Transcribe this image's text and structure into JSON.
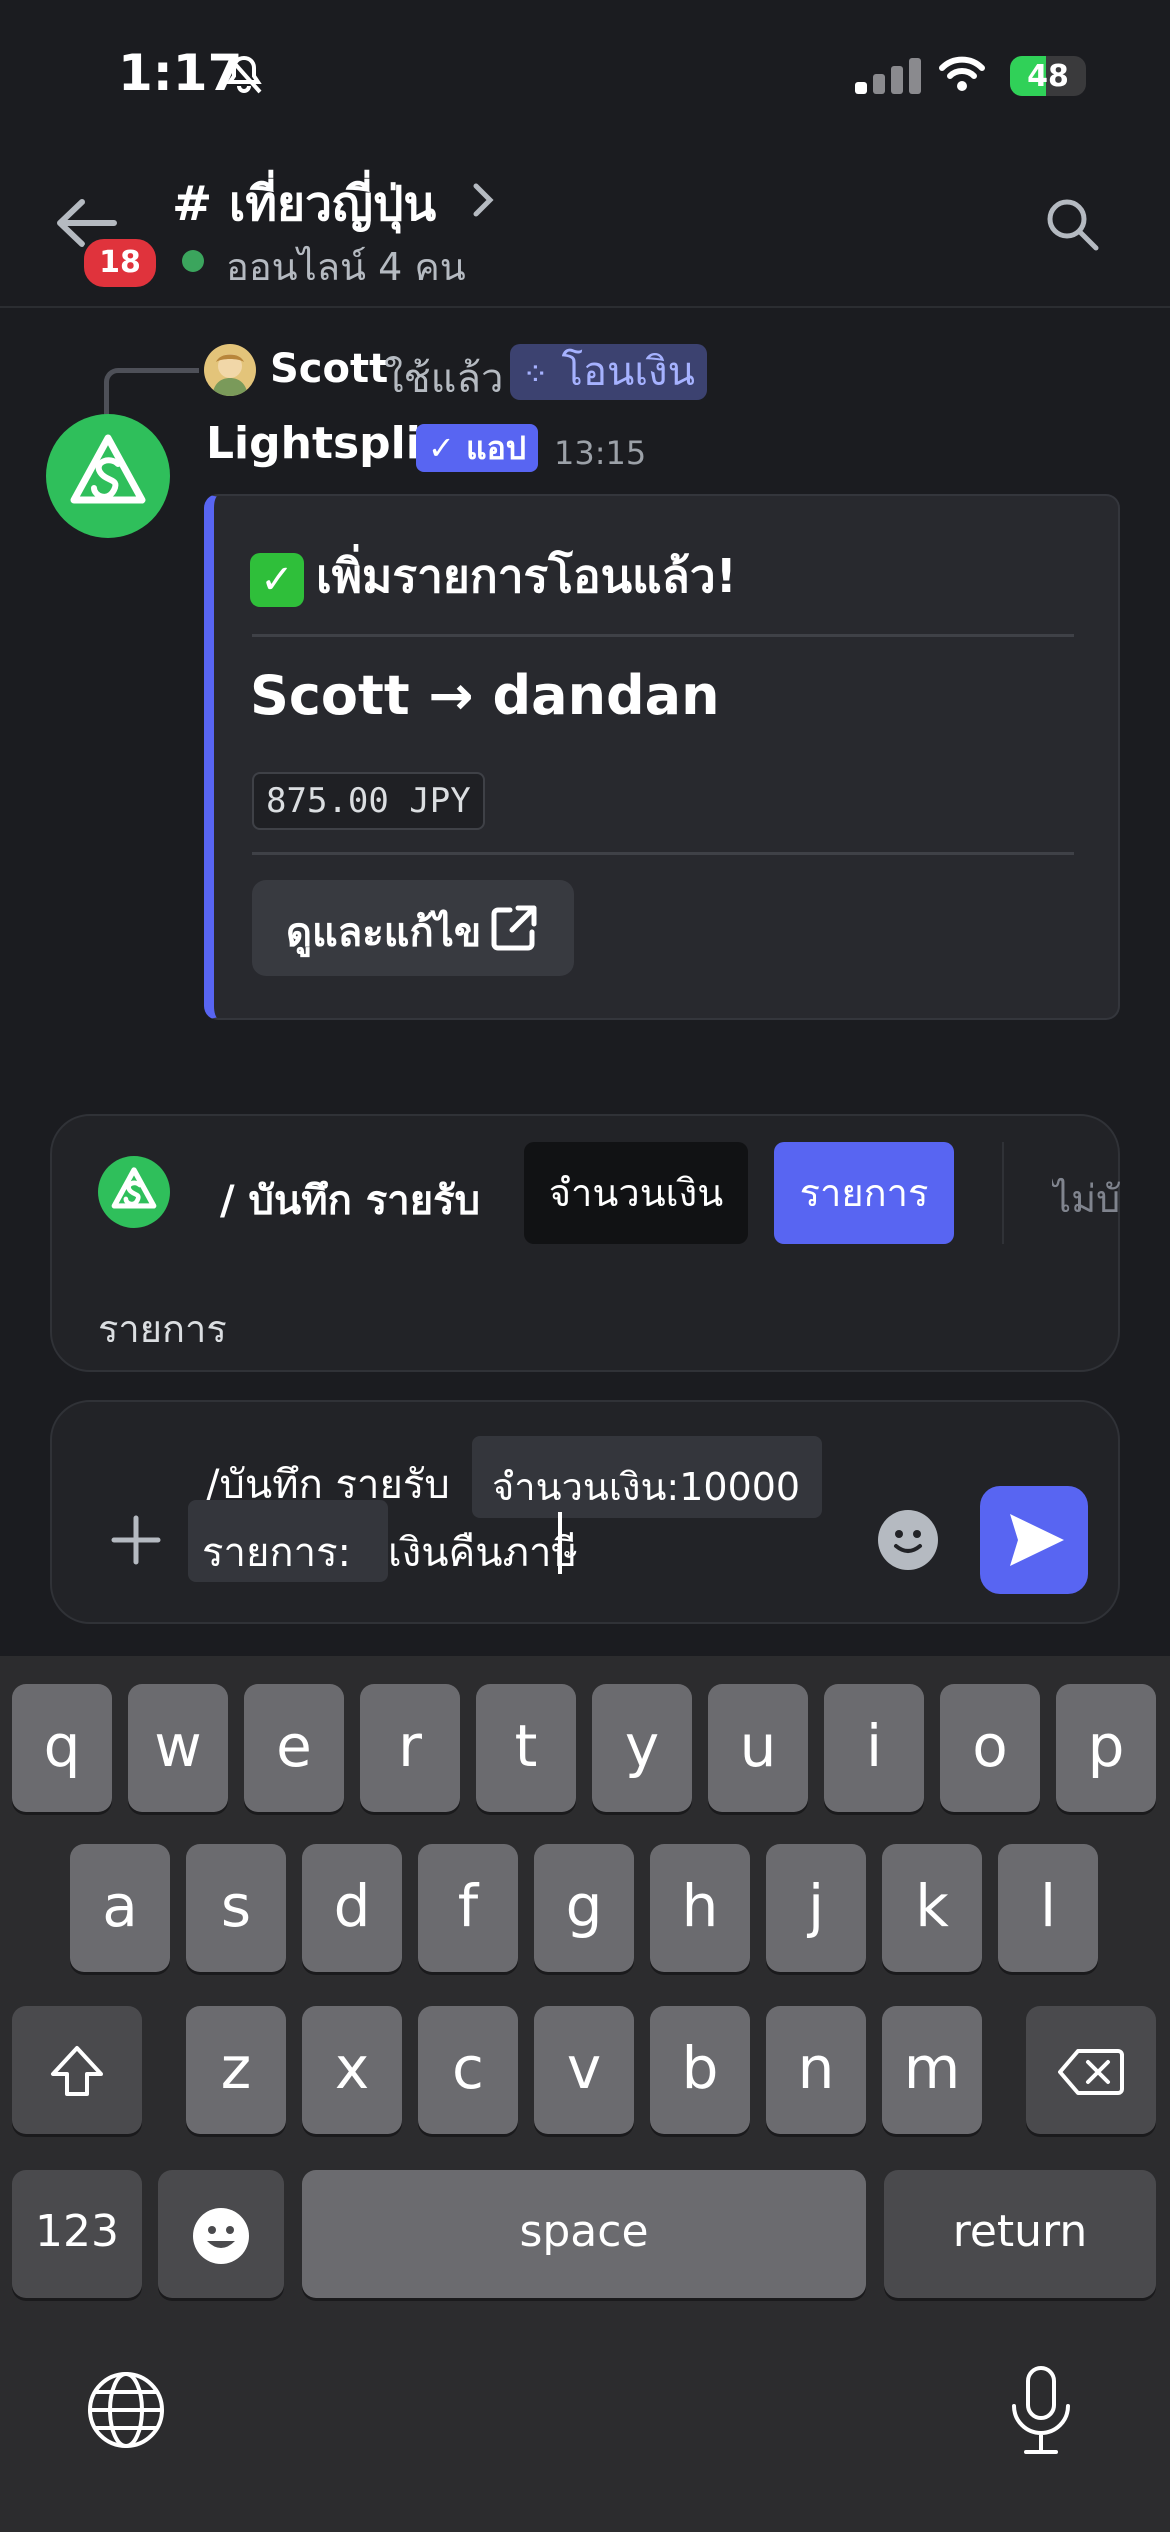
{
  "status_bar": {
    "time": "1:17",
    "battery": "48",
    "battery_level": 0.48
  },
  "header": {
    "back_badge": "18",
    "channel": "# เที่ยวญี่ปุ่น",
    "online": "ออนไลน์ 4 คน"
  },
  "message": {
    "reply": {
      "user": "Scott",
      "used": "ใช้แล้ว",
      "command": "โอนเงิน"
    },
    "author": "Lightsplit",
    "app_tag": "แอป",
    "time": "13:15",
    "embed": {
      "title": "เพิ่มรายการโอนแล้ว!",
      "transfer": "Scott → dandan",
      "amount": "875.00 JPY",
      "button": "ดูและแก้ไข"
    }
  },
  "command_bar": {
    "command": "/ บันทึก รายรับ",
    "options": [
      "จำนวนเงิน",
      "รายการ",
      "ไม่บังคับ"
    ],
    "hint": "รายการ"
  },
  "input": {
    "prefix": "/บันทึก รายรับ",
    "chip1": "จำนวนเงิน:10000",
    "chip2": "รายการ:",
    "value": "เงินคืนภาษี"
  },
  "keyboard": {
    "row1": [
      "q",
      "w",
      "e",
      "r",
      "t",
      "y",
      "u",
      "i",
      "o",
      "p"
    ],
    "row2": [
      "a",
      "s",
      "d",
      "f",
      "g",
      "h",
      "j",
      "k",
      "l"
    ],
    "row3": [
      "z",
      "x",
      "c",
      "v",
      "b",
      "n",
      "m"
    ],
    "numbers": "123",
    "space": "space",
    "return": "return"
  }
}
